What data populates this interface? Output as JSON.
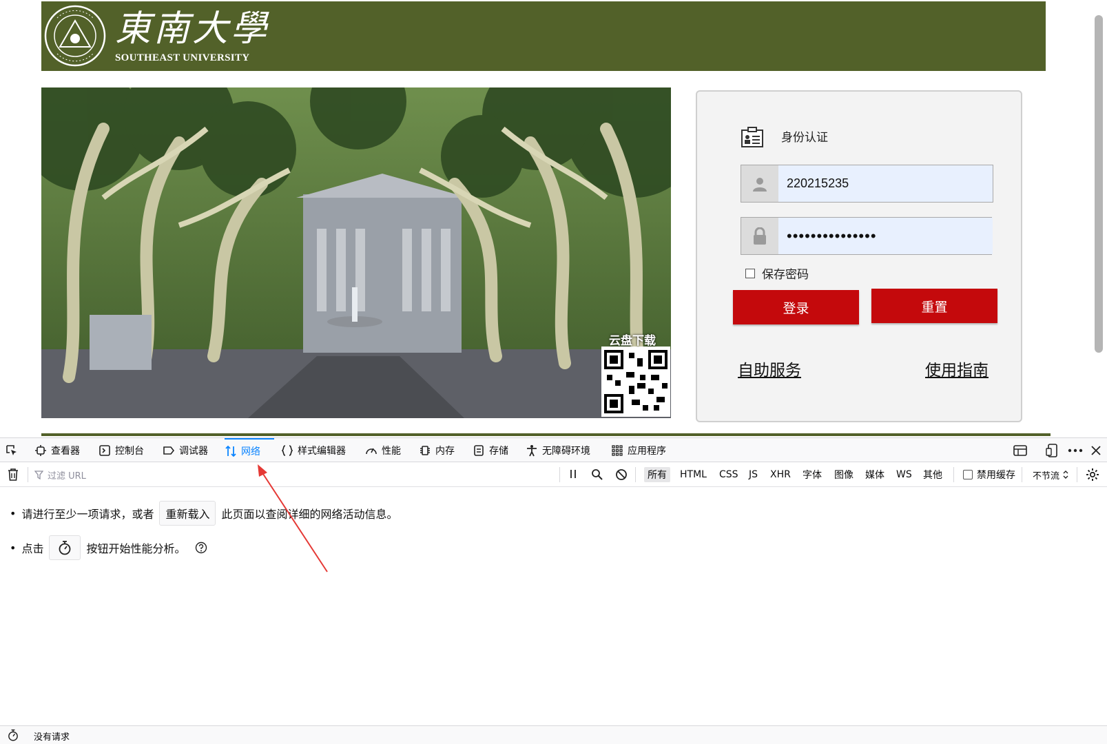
{
  "header": {
    "brand_cn": "東南大學",
    "brand_en": "SOUTHEAST UNIVERSITY",
    "seal_text": "SOUTHEAST UNIVERSITY"
  },
  "photo": {
    "qr_label": "云盘下载"
  },
  "login": {
    "title": "身份认证",
    "username_value": "220215235",
    "password_value": "•••••••••••••••",
    "remember_label": "保存密码",
    "login_label": "登录",
    "reset_label": "重置",
    "self_service_label": "自助服务",
    "guide_label": "使用指南"
  },
  "devtools": {
    "tabs": [
      {
        "label": "查看器"
      },
      {
        "label": "控制台"
      },
      {
        "label": "调试器"
      },
      {
        "label": "网络"
      },
      {
        "label": "样式编辑器"
      },
      {
        "label": "性能"
      },
      {
        "label": "内存"
      },
      {
        "label": "存储"
      },
      {
        "label": "无障碍环境"
      },
      {
        "label": "应用程序"
      }
    ],
    "active_tab": "网络",
    "filter_placeholder": "过滤 URL",
    "type_filters": [
      "所有",
      "HTML",
      "CSS",
      "JS",
      "XHR",
      "字体",
      "图像",
      "媒体",
      "WS",
      "其他"
    ],
    "disable_cache_label": "禁用缓存",
    "throttle_label": "不节流",
    "message1_before": "请进行至少一项请求，或者",
    "message1_button": "重新载入",
    "message1_after": "此页面以查阅详细的网络活动信息。",
    "message2_before": "点击",
    "message2_after": "按钮开始性能分析。",
    "status_text": "没有请求"
  },
  "colors": {
    "header_green": "#526129",
    "button_red": "#c4090c",
    "devtools_accent": "#0a84ff",
    "annotation_arrow": "#e53935"
  }
}
